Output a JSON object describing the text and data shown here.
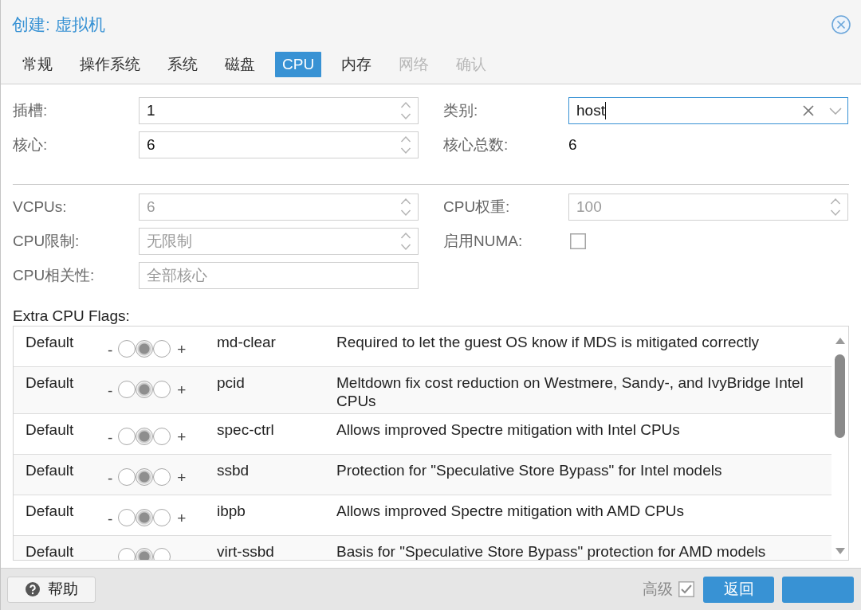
{
  "window": {
    "title": "创建: 虚拟机"
  },
  "tabs": [
    {
      "label": "常规",
      "selected": false,
      "disabled": false
    },
    {
      "label": "操作系统",
      "selected": false,
      "disabled": false
    },
    {
      "label": "系统",
      "selected": false,
      "disabled": false
    },
    {
      "label": "磁盘",
      "selected": false,
      "disabled": false
    },
    {
      "label": "CPU",
      "selected": true,
      "disabled": false
    },
    {
      "label": "内存",
      "selected": false,
      "disabled": false
    },
    {
      "label": "网络",
      "selected": false,
      "disabled": true
    },
    {
      "label": "确认",
      "selected": false,
      "disabled": true
    }
  ],
  "form": {
    "basic": [
      {
        "label": "插槽:",
        "kind": "spinner",
        "value": "1"
      },
      {
        "label": "类别:",
        "kind": "combo",
        "value": "host",
        "focused": true
      },
      {
        "label": "核心:",
        "kind": "spinner",
        "value": "6"
      },
      {
        "label": "核心总数:",
        "kind": "display",
        "value": "6"
      }
    ],
    "advanced": [
      {
        "label": "VCPUs:",
        "kind": "spinner",
        "placeholder": "6"
      },
      {
        "label": "CPU权重:",
        "kind": "spinner",
        "placeholder": "100"
      },
      {
        "label": "CPU限制:",
        "kind": "spinner",
        "placeholder": "无限制"
      },
      {
        "label": "启用NUMA:",
        "kind": "checkbox",
        "checked": false
      },
      {
        "label": "CPU相关性:",
        "kind": "text",
        "placeholder": "全部核心"
      }
    ]
  },
  "extra_flags": {
    "label": "Extra CPU Flags:",
    "rows": [
      {
        "state": "Default",
        "minus": "-",
        "radios": [
          {
            "selected": false
          },
          {
            "selected": true
          },
          {
            "selected": false
          }
        ],
        "plus": "+",
        "flag": "md-clear",
        "description": "Required to let the guest OS know if MDS is mitigated correctly"
      },
      {
        "state": "Default",
        "minus": "-",
        "radios": [
          {
            "selected": false
          },
          {
            "selected": true
          },
          {
            "selected": false
          }
        ],
        "plus": "+",
        "flag": "pcid",
        "description": "Meltdown fix cost reduction on Westmere, Sandy-, and IvyBridge Intel CPUs"
      },
      {
        "state": "Default",
        "minus": "-",
        "radios": [
          {
            "selected": false
          },
          {
            "selected": true
          },
          {
            "selected": false
          }
        ],
        "plus": "+",
        "flag": "spec-ctrl",
        "description": "Allows improved Spectre mitigation with Intel CPUs"
      },
      {
        "state": "Default",
        "minus": "-",
        "radios": [
          {
            "selected": false
          },
          {
            "selected": true
          },
          {
            "selected": false
          }
        ],
        "plus": "+",
        "flag": "ssbd",
        "description": "Protection for \"Speculative Store Bypass\" for Intel models"
      },
      {
        "state": "Default",
        "minus": "-",
        "radios": [
          {
            "selected": false
          },
          {
            "selected": true
          },
          {
            "selected": false
          }
        ],
        "plus": "+",
        "flag": "ibpb",
        "description": "Allows improved Spectre mitigation with AMD CPUs"
      },
      {
        "state": "Default",
        "radios": [
          {
            "selected": false
          },
          {
            "selected": true
          },
          {
            "selected": false
          }
        ],
        "flag": "virt-ssbd",
        "description": "Basis for \"Speculative Store Bypass\" protection for AMD models"
      }
    ]
  },
  "footer": {
    "help_button": "帮助",
    "advanced": {
      "label": "高级",
      "checked": true
    },
    "buttons": [
      {
        "label": "返回",
        "kind": "primary"
      },
      {
        "kind": "primary"
      }
    ]
  }
}
